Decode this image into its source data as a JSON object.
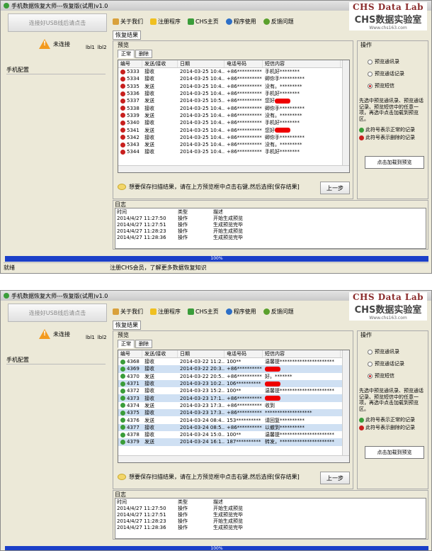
{
  "app_title": "手机数据恢复大师---恢复版(试用)v1.0",
  "brand": {
    "line1": "CHS Data Lab",
    "line2": "CHS数据实验室",
    "line3": "Www.chs163.com"
  },
  "left": {
    "connect_button": "连接好USB线后请点击",
    "status": "未连接",
    "lbl1": "lbl1",
    "lbl2": "lbl2",
    "phone_config": "手机配置"
  },
  "toolbar": {
    "about": "关于我们",
    "register": "注册程序",
    "home": "CHS主页",
    "usage": "程序使用",
    "feedback": "反馈问题"
  },
  "result_label": "恢复结果",
  "preview": {
    "title": "预览",
    "tab_normal": "正常",
    "tab_deleted": "删除"
  },
  "columns": {
    "id": "编号",
    "direction": "发送/接收",
    "date": "日期",
    "phone": "电话号码",
    "content": "短信内容"
  },
  "ops": {
    "title": "操作",
    "opt_contacts": "预览通讯录",
    "opt_calls": "预览通话记录",
    "opt_sms": "预览短信",
    "desc": "先选中预览通讯录、预览通话记录、预览短信中的任意一项，再选中点击加载到预览区。",
    "legend_normal": "此符号表示正常的记录",
    "legend_deleted": "此符号表示删除的记录",
    "load_button": "点击加载到预览"
  },
  "hint": "想要保存扫描结果，请在上方预览框中点击右键,然后选择[保存结果]",
  "prev_button": "上一步",
  "log": {
    "title": "日志",
    "col_time": "时间",
    "col_type": "类型",
    "col_desc": "描述",
    "rows1": [
      {
        "t": "2014/4/27 11:27:50",
        "type": "操作",
        "d": "开始生成预览"
      },
      {
        "t": "2014/4/27 11:27:51",
        "type": "操作",
        "d": "生成预览完毕"
      },
      {
        "t": "2014/4/27 11:28:23",
        "type": "操作",
        "d": "开始生成预览"
      },
      {
        "t": "2014/4/27 11:28:36",
        "type": "操作",
        "d": "生成预览完毕"
      }
    ],
    "rows2": [
      {
        "t": "2014/4/27 11:27:50",
        "type": "操作",
        "d": "开始生成预览"
      },
      {
        "t": "2014/4/27 11:27:51",
        "type": "操作",
        "d": "生成预览完毕"
      },
      {
        "t": "2014/4/27 11:28:23",
        "type": "操作",
        "d": "开始生成预览"
      },
      {
        "t": "2014/4/27 11:28:36",
        "type": "操作",
        "d": "生成预览完毕"
      }
    ]
  },
  "progress_text": "100%",
  "status_bar": {
    "ready": "就绪",
    "msg": "注册CHS会员，了解更多数据恢复知识"
  },
  "rows1": [
    {
      "id": "5333",
      "dir": "接收",
      "date": "2014-03-25 10:4...",
      "phone": "+86**********",
      "content": "手机好********",
      "status": "deleted"
    },
    {
      "id": "5334",
      "dir": "接收",
      "date": "2014-03-25 10:4...",
      "phone": "+86**********",
      "content": "卿你手**********",
      "status": "deleted"
    },
    {
      "id": "5335",
      "dir": "发送",
      "date": "2014-03-25 10:4...",
      "phone": "+86**********",
      "content": "没有。*********",
      "status": "deleted"
    },
    {
      "id": "5336",
      "dir": "接收",
      "date": "2014-03-25 10:4...",
      "phone": "+86**********",
      "content": "手机好********",
      "status": "deleted"
    },
    {
      "id": "5337",
      "dir": "发送",
      "date": "2014-03-25 10:5...",
      "phone": "+86**********",
      "content": "您好",
      "status": "deleted",
      "redact": true
    },
    {
      "id": "5338",
      "dir": "接收",
      "date": "2014-03-25 10:4...",
      "phone": "+86**********",
      "content": "卿你手**********",
      "status": "deleted"
    },
    {
      "id": "5339",
      "dir": "发送",
      "date": "2014-03-25 10:4...",
      "phone": "+86**********",
      "content": "没有。*********",
      "status": "deleted"
    },
    {
      "id": "5340",
      "dir": "接收",
      "date": "2014-03-25 10:4...",
      "phone": "+86**********",
      "content": "手机好********",
      "status": "deleted"
    },
    {
      "id": "5341",
      "dir": "发送",
      "date": "2014-03-25 10:4...",
      "phone": "+86**********",
      "content": "您好",
      "status": "deleted",
      "redact": true
    },
    {
      "id": "5342",
      "dir": "接收",
      "date": "2014-03-25 10:4...",
      "phone": "+86**********",
      "content": "卿你手**********",
      "status": "deleted"
    },
    {
      "id": "5343",
      "dir": "发送",
      "date": "2014-03-25 10:4...",
      "phone": "+86**********",
      "content": "没有。*********",
      "status": "deleted"
    },
    {
      "id": "5344",
      "dir": "接收",
      "date": "2014-03-25 10:4...",
      "phone": "+86**********",
      "content": "手机好********",
      "status": "deleted"
    }
  ],
  "rows2": [
    {
      "id": "4368",
      "dir": "接收",
      "date": "2014-03-22 11:2...",
      "phone": "100**",
      "content": "温馨提**********************",
      "status": "normal"
    },
    {
      "id": "4369",
      "dir": "接收",
      "date": "2014-03-22 20:3...",
      "phone": "+86**********",
      "content": "",
      "status": "normal",
      "sel": true,
      "redact": true
    },
    {
      "id": "4370",
      "dir": "发送",
      "date": "2014-03-22 20:5...",
      "phone": "+86**********",
      "content": "好。*******",
      "status": "normal"
    },
    {
      "id": "4371",
      "dir": "接收",
      "date": "2014-03-23 10:2...",
      "phone": "106**********",
      "content": "",
      "status": "normal",
      "sel": true,
      "redact": true
    },
    {
      "id": "4372",
      "dir": "接收",
      "date": "2014-03-23 15:2...",
      "phone": "100**",
      "content": "温馨提**********************",
      "status": "normal"
    },
    {
      "id": "4373",
      "dir": "接收",
      "date": "2014-03-23 17:1...",
      "phone": "+86**********",
      "content": "",
      "status": "normal",
      "sel": true,
      "redact": true
    },
    {
      "id": "4374",
      "dir": "发送",
      "date": "2014-03-23 17:3...",
      "phone": "+86**********",
      "content": "收到",
      "status": "normal"
    },
    {
      "id": "4375",
      "dir": "接收",
      "date": "2014-03-23 17:3...",
      "phone": "+86**********",
      "content": "*******************",
      "status": "normal",
      "sel": true
    },
    {
      "id": "4376",
      "dir": "发送",
      "date": "2014-03-24 08:4...",
      "phone": "153**********",
      "content": "请回复**********",
      "status": "normal"
    },
    {
      "id": "4377",
      "dir": "接收",
      "date": "2014-03-24 08:5...",
      "phone": "+86**********",
      "content": "以撤到**********",
      "status": "normal",
      "sel": true
    },
    {
      "id": "4378",
      "dir": "接收",
      "date": "2014-03-24 15:0...",
      "phone": "100**",
      "content": "温馨提**********************",
      "status": "normal"
    },
    {
      "id": "4379",
      "dir": "发送",
      "date": "2014-03-24 16:1...",
      "phone": "187**********",
      "content": "转发，**********************",
      "status": "normal",
      "sel": true
    }
  ]
}
